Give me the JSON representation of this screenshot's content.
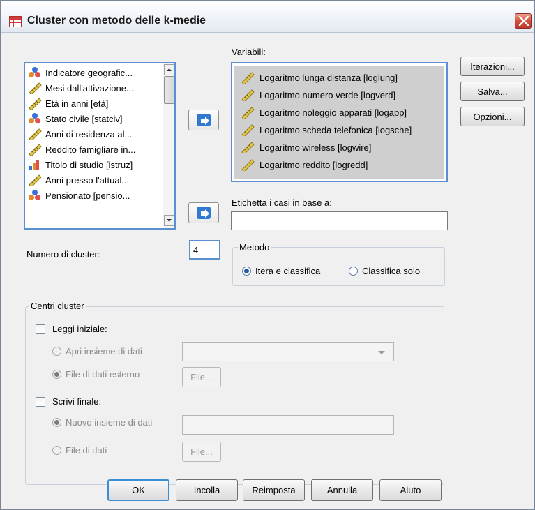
{
  "window": {
    "title": "Cluster con metodo delle k-medie"
  },
  "source_list": {
    "items": [
      {
        "label": "Indicatore geografic...",
        "icon": "nominal-icon"
      },
      {
        "label": "Mesi dall'attivazione...",
        "icon": "scale-icon"
      },
      {
        "label": "Età in anni [età]",
        "icon": "scale-icon"
      },
      {
        "label": "Stato civile [statciv]",
        "icon": "nominal-icon"
      },
      {
        "label": "Anni di residenza al...",
        "icon": "scale-icon"
      },
      {
        "label": "Reddito famigliare in...",
        "icon": "scale-icon"
      },
      {
        "label": "Titolo di studio [istruz]",
        "icon": "ordinal-icon"
      },
      {
        "label": "Anni presso l'attual...",
        "icon": "scale-icon"
      },
      {
        "label": "Pensionato [pensio...",
        "icon": "nominal-icon"
      }
    ]
  },
  "variables": {
    "label": "Variabili:",
    "items": [
      "Logaritmo lunga distanza [loglung]",
      "Logaritmo numero verde [logverd]",
      "Logaritmo noleggio apparati [logapp]",
      "Logaritmo scheda telefonica [logsche]",
      "Logaritmo wireless [logwire]",
      "Logaritmo reddito [logredd]"
    ]
  },
  "label_cases": {
    "label": "Etichetta i casi in base a:",
    "value": ""
  },
  "side_buttons": {
    "iterations": "Iterazioni...",
    "save": "Salva...",
    "options": "Opzioni..."
  },
  "num_clusters": {
    "label": "Numero di cluster:",
    "value": "4"
  },
  "method": {
    "legend": "Metodo",
    "option_iterate": "Itera e classifica",
    "option_classify": "Classifica solo",
    "selected": "iterate"
  },
  "centers": {
    "legend": "Centri cluster",
    "read_initial": "Leggi iniziale:",
    "open_dataset": "Apri insieme di dati",
    "external_file": "File di dati esterno",
    "file_button": "File...",
    "write_final": "Scrivi finale:",
    "new_dataset": "Nuovo insieme di dati",
    "data_file": "File di dati"
  },
  "footer": {
    "ok": "OK",
    "paste": "Incolla",
    "reset": "Reimposta",
    "cancel": "Annulla",
    "help": "Aiuto"
  },
  "colors": {
    "list_border": "#5b8fd0",
    "arrow_blue": "#2f79d0",
    "selected_bg": "#cfcfcf"
  }
}
